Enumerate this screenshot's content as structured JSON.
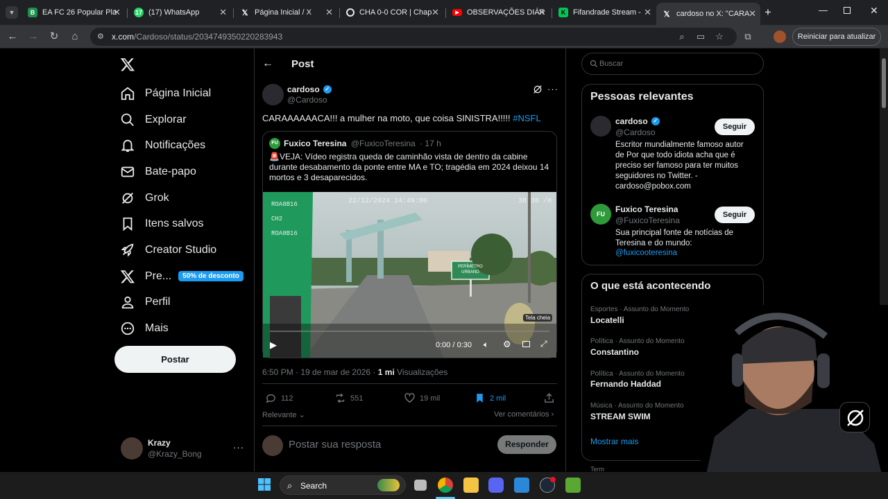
{
  "browser": {
    "tabs": [
      {
        "title": "EA FC 26 Popular Pla",
        "icon": "futbin-icon",
        "color": "#1e8f4e"
      },
      {
        "title": "(17) WhatsApp",
        "icon": "whatsapp-icon",
        "color": "#25d366",
        "badge": "17"
      },
      {
        "title": "Página Inicial / X",
        "icon": "x-icon",
        "color": "#202124"
      },
      {
        "title": "CHA 0-0 COR | Chap",
        "icon": "flashscore-icon",
        "color": "#202124"
      },
      {
        "title": "OBSERVAÇÕES DIÁR",
        "icon": "youtube-icon",
        "color": "#ff0000"
      },
      {
        "title": "Fifandrade Stream - ",
        "icon": "twitch-icon",
        "color": "#00c853"
      },
      {
        "title": "cardoso no X: \"CARA",
        "icon": "x-icon",
        "color": "#202124",
        "active": true
      }
    ],
    "url_host": "x.com",
    "url_path": "/Cardoso/status/2034749350220283943",
    "restart_label": "Reiniciar para atualizar"
  },
  "nav": {
    "items": [
      {
        "label": "Página Inicial",
        "icon": "home-icon"
      },
      {
        "label": "Explorar",
        "icon": "search-icon"
      },
      {
        "label": "Notificações",
        "icon": "bell-icon"
      },
      {
        "label": "Bate-papo",
        "icon": "mail-icon"
      },
      {
        "label": "Grok",
        "icon": "grok-icon"
      },
      {
        "label": "Itens salvos",
        "icon": "bookmark-icon"
      },
      {
        "label": "Creator Studio",
        "icon": "rocket-icon"
      },
      {
        "label": "Pre...",
        "icon": "x-premium-icon"
      },
      {
        "label": "Perfil",
        "icon": "person-icon"
      },
      {
        "label": "Mais",
        "icon": "more-circle-icon"
      }
    ],
    "premium_badge": "50% de desconto",
    "post_button": "Postar",
    "account": {
      "name": "Krazy",
      "handle": "@Krazy_Bong"
    }
  },
  "post": {
    "header_title": "Post",
    "author_name": "cardoso",
    "author_handle": "@Cardoso",
    "text": "CARAAAAAACA!!! a mulher na moto, que coisa SINISTRA!!!!! ",
    "hashtag": "#NSFL",
    "quote": {
      "author_name": "Fuxico Teresina",
      "author_handle": "@FuxicoTeresina",
      "time": "· 17 h",
      "avatar_text": "FU",
      "text": "🚨VEJA: Vídeo registra queda de caminhão vista de dentro da cabine durante desabamento da ponte entre MA e TO; tragédia em 2024 deixou 14 mortos e 3 desaparecidos."
    },
    "video": {
      "overlay_tl": "ROA8B16\nCH2\nROA8B16",
      "overlay_date": "22/12/2024 14:49:00",
      "overlay_tr": "38 36 /H",
      "sign_text": "PERÍMETRO URBANO",
      "time": "0:00 / 0:30",
      "fullscreen_tooltip": "Tela cheia",
      "progress": 0
    },
    "timestamp": "6:50 PM · 19 de mar de 2026 · ",
    "views_count": "1 mi",
    "views_label": " Visualizações",
    "replies": "112",
    "reposts": "551",
    "likes": "19 mil",
    "bookmarks": "2 mil",
    "sort_label": "Relevante",
    "view_comments": "Ver comentários",
    "reply_placeholder": "Postar sua resposta",
    "reply_button": "Responder"
  },
  "sidebar": {
    "search_placeholder": "Buscar",
    "relevant_title": "Pessoas relevantes",
    "people": [
      {
        "name": "cardoso",
        "handle": "@Cardoso",
        "verified": true,
        "follow": "Seguir",
        "bio": "Escritor mundialmente famoso autor de Por que todo idiota acha que é preciso ser famoso para ter muitos seguidores no Twitter. - cardoso@pobox.com"
      },
      {
        "name": "Fuxico Teresina",
        "handle": "@FuxicoTeresina",
        "verified": false,
        "follow": "Seguir",
        "bio": "Sua principal fonte de notícias de Teresina e do mundo:",
        "bio_link": "@fuxicooteresina"
      }
    ],
    "trends_title": "O que está acontecendo",
    "trends": [
      {
        "meta": "Esportes · Assunto do Momento",
        "name": "Locatelli"
      },
      {
        "meta": "Política · Assunto do Momento",
        "name": "Constantino"
      },
      {
        "meta": "Política · Assunto do Momento",
        "name": "Fernando Haddad"
      },
      {
        "meta": "Música · Assunto do Momento",
        "name": "STREAM SWIM"
      }
    ],
    "show_more": "Mostrar mais",
    "footer_partial": "Term"
  },
  "taskbar": {
    "search_label": "Search"
  }
}
